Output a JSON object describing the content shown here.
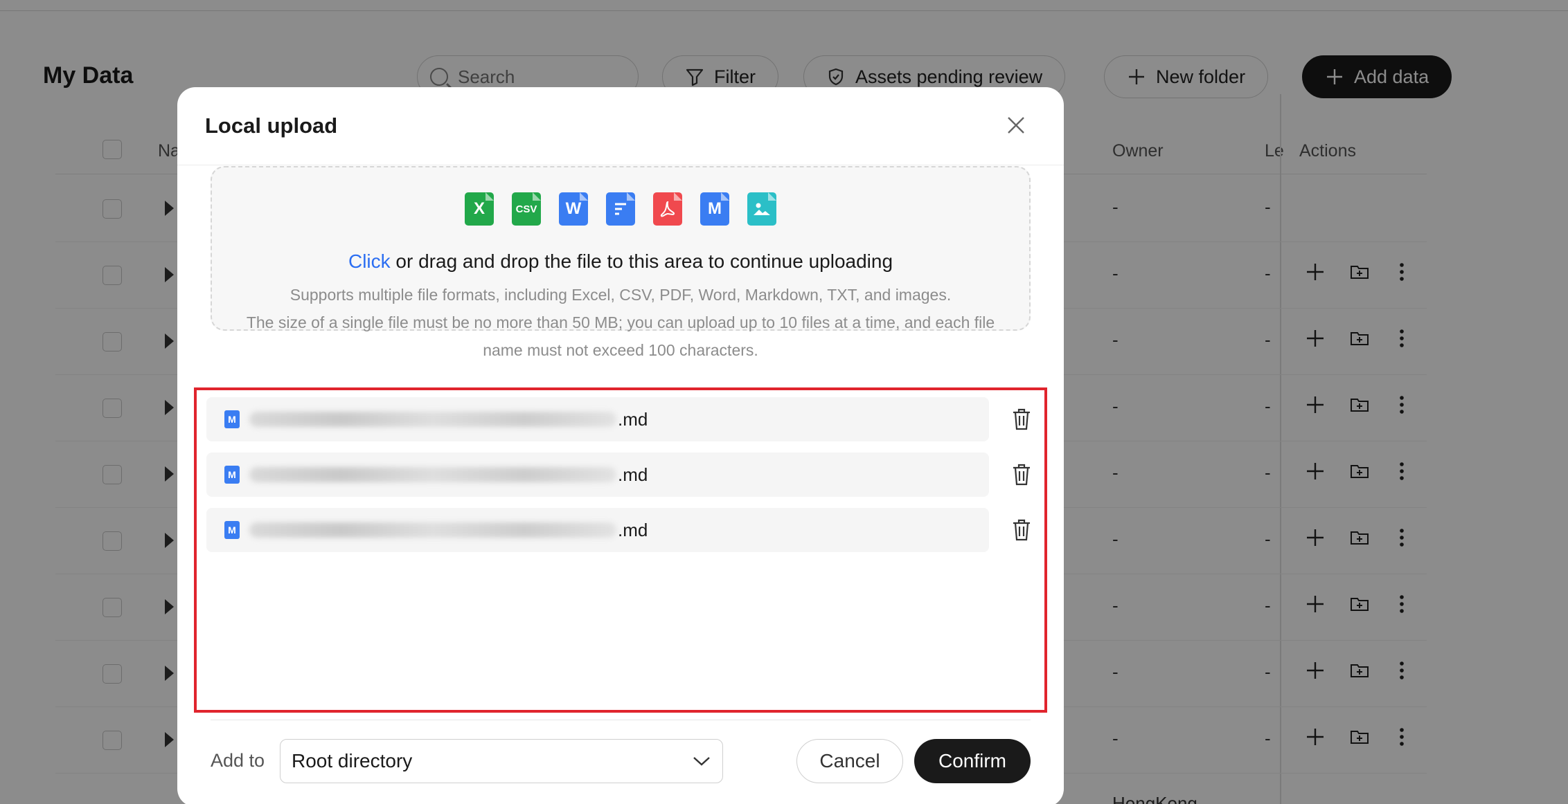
{
  "page": {
    "title": "My Data",
    "search_placeholder": "Search",
    "filter_label": "Filter",
    "pending_review_label": "Assets pending review",
    "new_folder_label": "New folder",
    "add_data_label": "Add data",
    "columns": {
      "name": "Na",
      "owner": "Owner",
      "level": "Le",
      "actions": "Actions"
    },
    "row_dash": "-",
    "partial_last_row_owner": "HongKong"
  },
  "modal": {
    "title": "Local upload",
    "file_type_icons": [
      {
        "name": "excel-file-icon",
        "glyph": "X",
        "color": "#22a84a"
      },
      {
        "name": "csv-file-icon",
        "glyph": "CSV",
        "color": "#22a84a"
      },
      {
        "name": "word-file-icon",
        "glyph": "W",
        "color": "#3a7df2"
      },
      {
        "name": "txt-file-icon",
        "glyph": "",
        "color": "#3a7df2"
      },
      {
        "name": "pdf-file-icon",
        "glyph": "",
        "color": "#f0494e"
      },
      {
        "name": "markdown-file-icon",
        "glyph": "M",
        "color": "#3a7df2"
      },
      {
        "name": "image-file-icon",
        "glyph": "",
        "color": "#2bbfc7"
      }
    ],
    "upload_click": "Click",
    "upload_text": " or drag and drop the file to this area to continue uploading",
    "formats_hint": "Supports multiple file formats, including Excel, CSV, PDF, Word, Markdown, TXT, and images.",
    "limits_hint_line1": "The size of a single file must be no more than 50 MB; you can upload up to 10 files at a time, and each file",
    "limits_hint_line2": "name must not exceed 100 characters.",
    "files": [
      {
        "ext": ".md"
      },
      {
        "ext": ".md"
      },
      {
        "ext": ".md"
      }
    ],
    "add_to_label": "Add to",
    "add_to_value": "Root directory",
    "cancel_label": "Cancel",
    "confirm_label": "Confirm"
  },
  "colors": {
    "accent_link": "#2b6ef2",
    "primary_button": "#1a1a1a",
    "highlight_border": "#e0242d"
  }
}
